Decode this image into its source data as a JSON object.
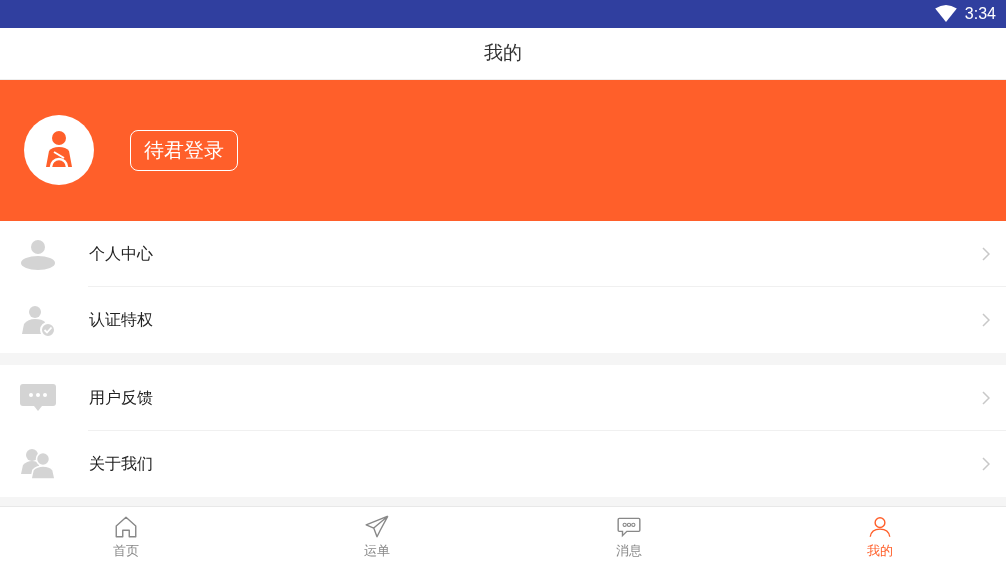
{
  "status_bar": {
    "time": "3:34"
  },
  "title": "我的",
  "profile": {
    "login_button": "待君登录"
  },
  "menu_groups": [
    {
      "items": [
        {
          "label": "个人中心"
        },
        {
          "label": "认证特权"
        }
      ]
    },
    {
      "items": [
        {
          "label": "用户反馈"
        },
        {
          "label": "关于我们"
        }
      ]
    }
  ],
  "tabs": [
    {
      "label": "首页",
      "selected": false
    },
    {
      "label": "运单",
      "selected": false
    },
    {
      "label": "消息",
      "selected": false
    },
    {
      "label": "我的",
      "selected": true
    }
  ]
}
